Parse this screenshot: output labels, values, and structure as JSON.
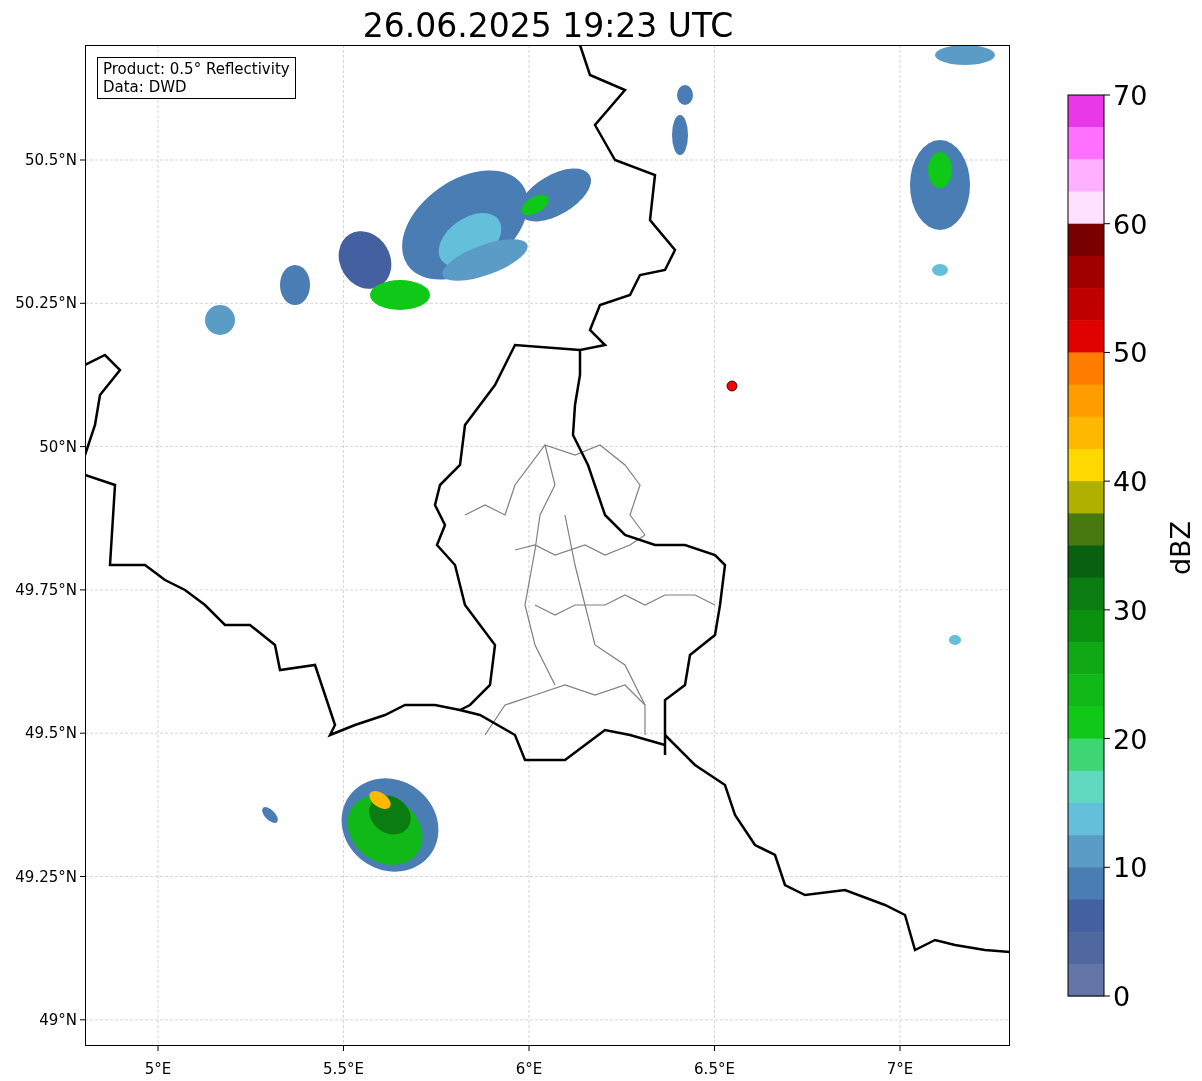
{
  "title": "26.06.2025 19:23 UTC",
  "info_box": [
    "Product: 0.5° Reflectivity",
    "Data: DWD"
  ],
  "map": {
    "y_ticks": [
      "50.5°N",
      "50.25°N",
      "50°N",
      "49.75°N",
      "49.5°N",
      "49.25°N",
      "49°N"
    ],
    "x_ticks": [
      "5°E",
      "5.5°E",
      "6°E",
      "6.5°E",
      "7°E"
    ]
  },
  "colorbar": {
    "label": "dBZ",
    "ticks": [
      "70",
      "60",
      "50",
      "40",
      "30",
      "20",
      "10",
      "0"
    ],
    "bins": [
      {
        "color": "#e838e8"
      },
      {
        "color": "#ff70ff"
      },
      {
        "color": "#ffb0ff"
      },
      {
        "color": "#ffe0ff"
      },
      {
        "color": "#780000"
      },
      {
        "color": "#a00000"
      },
      {
        "color": "#c00000"
      },
      {
        "color": "#e00000"
      },
      {
        "color": "#ff7c00"
      },
      {
        "color": "#ff9c00"
      },
      {
        "color": "#ffb800"
      },
      {
        "color": "#ffd800"
      },
      {
        "color": "#b0b000"
      },
      {
        "color": "#487810"
      },
      {
        "color": "#086010"
      },
      {
        "color": "#0a7c10"
      },
      {
        "color": "#0c9010"
      },
      {
        "color": "#10a814"
      },
      {
        "color": "#10b818"
      },
      {
        "color": "#10c818"
      },
      {
        "color": "#3ed672"
      },
      {
        "color": "#60d8c0"
      },
      {
        "color": "#64c0da"
      },
      {
        "color": "#5a9cc5"
      },
      {
        "color": "#4b7db5"
      },
      {
        "color": "#4460a0"
      },
      {
        "color": "#5068a0"
      },
      {
        "color": "#6475a8"
      }
    ]
  }
}
